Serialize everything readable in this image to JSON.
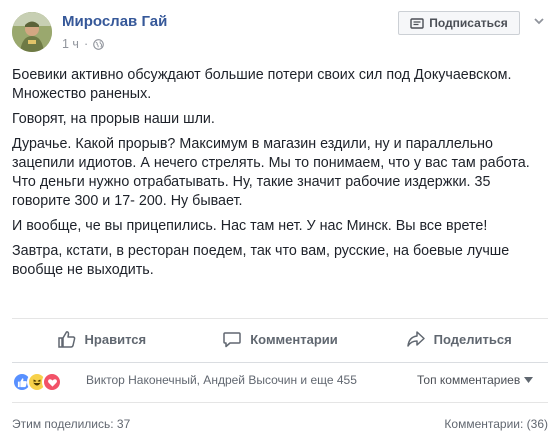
{
  "post": {
    "author": "Мирослав Гай",
    "time": "1 ч",
    "subscribe_label": "Подписаться",
    "paragraphs": [
      "Боевики активно обсуждают большие потери своих сил под Докучаевском. Множество раненых.",
      "Говорят, на прорыв наши шли.",
      "Дурачье. Какой прорыв? Максимум в магазин ездили, ну и параллельно зацепили идиотов. А нечего стрелять. Мы то понимаем, что у вас там работа. Что деньги нужно отрабатывать. Ну, такие значит рабочие издержки. 35 говорите 300 и 17- 200. Ну бывает.",
      "И вообще, че вы прицепились. Нас там нет. У нас Минск. Вы все врете!",
      "Завтра, кстати, в ресторан поедем, так что вам, русские, на боевые лучше вообще не выходить."
    ]
  },
  "actions": {
    "like": "Нравится",
    "comment": "Комментарии",
    "share": "Поделиться"
  },
  "reactions": {
    "names": "Виктор Наконечный, Андрей Высочин и еще 455",
    "sort_label": "Топ комментариев"
  },
  "footer": {
    "shares": "Этим поделились: 37",
    "comments": "Комментарии: (36)"
  },
  "colors": {
    "author_link": "#365899",
    "like_blue": "#5890ff",
    "love_red": "#f25268",
    "haha_yellow": "#f7d14a"
  }
}
